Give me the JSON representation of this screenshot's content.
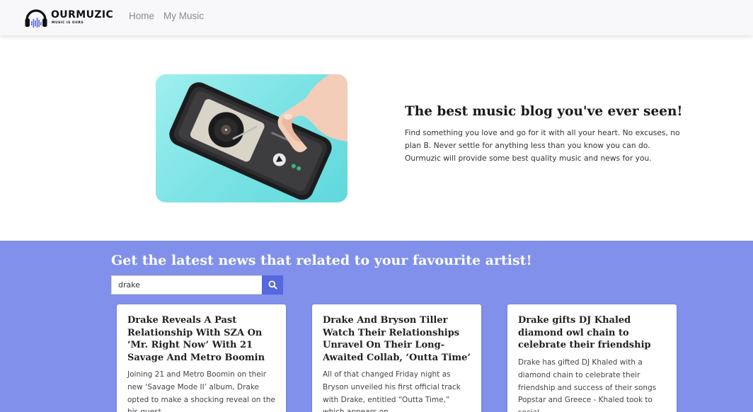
{
  "navbar": {
    "logo": {
      "title": "OURMUZIC",
      "tagline": "MUSIC IS OURS"
    },
    "links": [
      {
        "label": "Home"
      },
      {
        "label": "My Music"
      }
    ]
  },
  "hero": {
    "title": "The best music blog you've ever seen!",
    "text": "Find something you love and go for it with all your heart. No excuses, no plan B. Never settle for anything less than you know you can do. Ourmuzic will provide some best quality music and news for you."
  },
  "news": {
    "heading": "Get the latest news that related to your favourite artist!",
    "search": {
      "value": "drake",
      "button_icon": "search-icon"
    },
    "cards": [
      {
        "title": "Drake Reveals A Past Relationship With SZA On ‘Mr. Right Now’ With 21 Savage And Metro Boomin",
        "text": "Joining 21 and Metro Boomin on their new ‘Savage Mode II’ album, Drake opted to make a shocking reveal on the his guest"
      },
      {
        "title": "Drake And Bryson Tiller Watch Their Relationships Unravel On Their Long-Awaited Collab, ‘Outta Time’",
        "text": "All of that changed Friday night as Bryson unveiled his first official track with Drake, entitled “Outta Time,” which appears on"
      },
      {
        "title": "Drake gifts DJ Khaled diamond owl chain to celebrate their friendship",
        "text": "Drake has gifted DJ Khaled with a diamond chain to celebrate their friendship and success of their songs Popstar and Greece - Khaled took to social"
      }
    ]
  },
  "colors": {
    "navbar_bg": "#f8f8fa",
    "news_section_bg": "#8190ea",
    "search_button_bg": "#5568e0",
    "hero_image_teal": "#7fe4e6"
  }
}
